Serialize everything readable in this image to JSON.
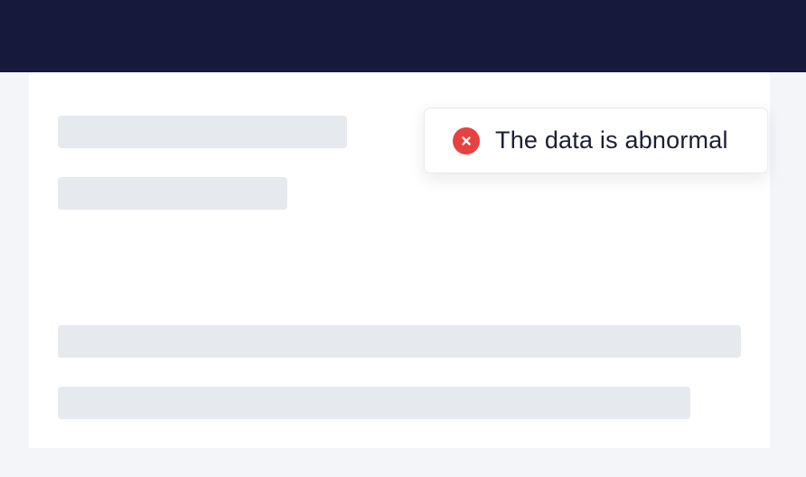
{
  "toast": {
    "message": "The data is abnormal",
    "type": "error",
    "icon": "error-circle-icon",
    "icon_color": "#e8413f"
  },
  "header": {
    "background_color": "#16193c"
  },
  "content": {
    "state": "loading",
    "skeleton_color": "#e6e9ee"
  }
}
